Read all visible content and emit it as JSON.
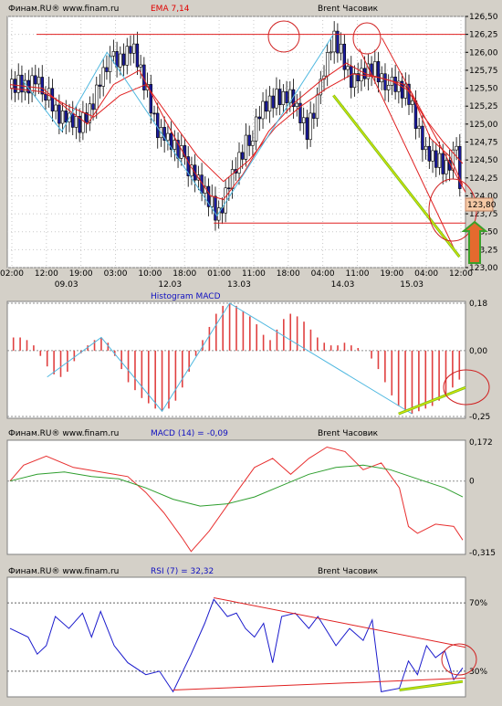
{
  "colors": {
    "background": "#D4D0C8",
    "panel": "#FFFFFF",
    "header_text": "#000000",
    "title_red": "#E00000",
    "title_blue": "#1010C0",
    "candle_up": "#FFFFFF",
    "candle_down": "#1A1AA0",
    "ema": "#E02020",
    "trend_cyan": "#4FB8E0",
    "green_line": "#7CC31E",
    "yellow_line": "#E8E800",
    "macd_line": "#E83030",
    "signal_line": "#2E9E2E",
    "rsi_line": "#1A1ACC",
    "hist_bar": "#E04040",
    "circle": "#D02020",
    "price_box": "#F5C9A5",
    "arrow_fill": "#E56A2E",
    "arrow_border": "#3AA02A"
  },
  "chart_data": [
    {
      "type": "candlestick",
      "header": {
        "source": "Финам.RU® www.finam.ru",
        "indicator": "EMA 7,14",
        "instrument": "Brent Часовик"
      },
      "y_ticks": [
        "126,50",
        "126,25",
        "126,00",
        "125,75",
        "125,50",
        "125,25",
        "125,00",
        "124,75",
        "124,50",
        "124,25",
        "124,00",
        "123,75",
        "123,50",
        "123,25",
        "123,00"
      ],
      "ylim": [
        123.0,
        126.5
      ],
      "current_price": "123,80",
      "x_time_labels": [
        "02:00",
        "12:00",
        "19:00",
        "03:00",
        "10:00",
        "18:00",
        "01:00",
        "11:00",
        "18:00",
        "04:00",
        "11:00",
        "19:00",
        "04:00",
        "12:00"
      ],
      "x_date_labels": [
        "09.03",
        "12.03",
        "13.03",
        "14.03",
        "15.03"
      ],
      "x_range": [
        0,
        140
      ],
      "resistance": 126.25,
      "support": 123.62,
      "close_path": [
        [
          0,
          125.5
        ],
        [
          8,
          125.6
        ],
        [
          16,
          125.1
        ],
        [
          22,
          124.95
        ],
        [
          30,
          125.8
        ],
        [
          38,
          126.05
        ],
        [
          46,
          124.9
        ],
        [
          54,
          124.5
        ],
        [
          58,
          124.2
        ],
        [
          64,
          123.72
        ],
        [
          70,
          124.4
        ],
        [
          78,
          125.2
        ],
        [
          86,
          125.45
        ],
        [
          92,
          124.85
        ],
        [
          100,
          126.2
        ],
        [
          106,
          125.6
        ],
        [
          112,
          125.75
        ],
        [
          118,
          125.55
        ],
        [
          124,
          125.35
        ],
        [
          128,
          124.6
        ],
        [
          134,
          124.4
        ],
        [
          138,
          124.6
        ],
        [
          140,
          123.8
        ]
      ],
      "ema_fast": [
        [
          0,
          125.55
        ],
        [
          10,
          125.5
        ],
        [
          18,
          125.2
        ],
        [
          24,
          125.0
        ],
        [
          32,
          125.55
        ],
        [
          40,
          125.75
        ],
        [
          48,
          125.05
        ],
        [
          56,
          124.4
        ],
        [
          62,
          124.0
        ],
        [
          66,
          123.95
        ],
        [
          72,
          124.3
        ],
        [
          80,
          124.9
        ],
        [
          88,
          125.3
        ],
        [
          96,
          125.6
        ],
        [
          104,
          125.85
        ],
        [
          110,
          125.7
        ],
        [
          118,
          125.6
        ],
        [
          124,
          125.45
        ],
        [
          130,
          124.8
        ],
        [
          136,
          124.55
        ],
        [
          140,
          124.15
        ]
      ],
      "ema_slow": [
        [
          0,
          125.5
        ],
        [
          10,
          125.45
        ],
        [
          18,
          125.25
        ],
        [
          26,
          125.1
        ],
        [
          34,
          125.4
        ],
        [
          42,
          125.55
        ],
        [
          50,
          125.05
        ],
        [
          58,
          124.55
        ],
        [
          66,
          124.2
        ],
        [
          74,
          124.5
        ],
        [
          82,
          124.95
        ],
        [
          90,
          125.25
        ],
        [
          98,
          125.5
        ],
        [
          106,
          125.7
        ],
        [
          114,
          125.65
        ],
        [
          122,
          125.55
        ],
        [
          128,
          125.1
        ],
        [
          134,
          124.75
        ],
        [
          140,
          124.45
        ]
      ]
    },
    {
      "type": "bar",
      "header": {
        "indicator": "Histogram MACD"
      },
      "y_ticks": [
        "0,18",
        "0,00",
        "-0,25"
      ],
      "ylim": [
        -0.25,
        0.18
      ],
      "values": [
        0.05,
        0.05,
        0.04,
        0.02,
        -0.02,
        -0.06,
        -0.09,
        -0.1,
        -0.08,
        -0.04,
        -0.01,
        0.02,
        0.04,
        0.05,
        0.03,
        -0.02,
        -0.07,
        -0.12,
        -0.15,
        -0.18,
        -0.2,
        -0.22,
        -0.23,
        -0.22,
        -0.19,
        -0.14,
        -0.08,
        -0.02,
        0.04,
        0.09,
        0.14,
        0.17,
        0.18,
        0.17,
        0.15,
        0.13,
        0.1,
        0.06,
        0.04,
        0.08,
        0.12,
        0.14,
        0.13,
        0.11,
        0.08,
        0.05,
        0.03,
        0.02,
        0.02,
        0.03,
        0.02,
        0.01,
        0.0,
        -0.03,
        -0.07,
        -0.12,
        -0.17,
        -0.21,
        -0.23,
        -0.24,
        -0.23,
        -0.22,
        -0.21,
        -0.19,
        -0.17,
        -0.14,
        -0.11
      ]
    },
    {
      "type": "line",
      "header": {
        "source": "Финам.RU® www.finam.ru",
        "indicator": "MACD (14) = -0,09",
        "instrument": "Brent Часовик"
      },
      "y_ticks": [
        "0,172",
        "0",
        "-0,315"
      ],
      "ylim": [
        -0.315,
        0.172
      ],
      "x_range": [
        0,
        100
      ],
      "series": [
        {
          "values": [
            [
              0,
              0.0
            ],
            [
              3,
              0.07
            ],
            [
              8,
              0.11
            ],
            [
              14,
              0.06
            ],
            [
              20,
              0.04
            ],
            [
              26,
              0.02
            ],
            [
              30,
              -0.05
            ],
            [
              34,
              -0.14
            ],
            [
              38,
              -0.25
            ],
            [
              40,
              -0.31
            ],
            [
              44,
              -0.22
            ],
            [
              50,
              -0.05
            ],
            [
              54,
              0.06
            ],
            [
              58,
              0.1
            ],
            [
              62,
              0.03
            ],
            [
              66,
              0.1
            ],
            [
              70,
              0.15
            ],
            [
              74,
              0.13
            ],
            [
              78,
              0.05
            ],
            [
              82,
              0.08
            ],
            [
              86,
              -0.03
            ],
            [
              88,
              -0.2
            ],
            [
              90,
              -0.23
            ],
            [
              94,
              -0.19
            ],
            [
              98,
              -0.2
            ],
            [
              100,
              -0.26
            ]
          ]
        },
        {
          "values": [
            [
              0,
              0.0
            ],
            [
              6,
              0.03
            ],
            [
              12,
              0.04
            ],
            [
              18,
              0.02
            ],
            [
              24,
              0.01
            ],
            [
              30,
              -0.03
            ],
            [
              36,
              -0.08
            ],
            [
              42,
              -0.11
            ],
            [
              48,
              -0.1
            ],
            [
              54,
              -0.07
            ],
            [
              60,
              -0.02
            ],
            [
              66,
              0.03
            ],
            [
              72,
              0.06
            ],
            [
              78,
              0.07
            ],
            [
              84,
              0.05
            ],
            [
              90,
              0.01
            ],
            [
              96,
              -0.03
            ],
            [
              100,
              -0.07
            ]
          ]
        }
      ]
    },
    {
      "type": "line",
      "header": {
        "source": "Финам.RU® www.finam.ru",
        "indicator": "RSI (7) = 32,32",
        "instrument": "Brent Часовик"
      },
      "y_ticks": [
        "70%",
        "30%"
      ],
      "ylim": [
        15,
        85
      ],
      "x_range": [
        0,
        100
      ],
      "values": [
        [
          0,
          55
        ],
        [
          4,
          50
        ],
        [
          6,
          40
        ],
        [
          8,
          45
        ],
        [
          10,
          62
        ],
        [
          13,
          55
        ],
        [
          16,
          64
        ],
        [
          18,
          50
        ],
        [
          20,
          65
        ],
        [
          23,
          45
        ],
        [
          26,
          35
        ],
        [
          30,
          28
        ],
        [
          33,
          30
        ],
        [
          36,
          18
        ],
        [
          40,
          40
        ],
        [
          43,
          58
        ],
        [
          45,
          72
        ],
        [
          48,
          62
        ],
        [
          50,
          64
        ],
        [
          52,
          55
        ],
        [
          54,
          50
        ],
        [
          56,
          58
        ],
        [
          58,
          35
        ],
        [
          60,
          62
        ],
        [
          63,
          64
        ],
        [
          66,
          55
        ],
        [
          68,
          62
        ],
        [
          72,
          45
        ],
        [
          75,
          55
        ],
        [
          78,
          48
        ],
        [
          80,
          60
        ],
        [
          82,
          18
        ],
        [
          86,
          20
        ],
        [
          88,
          36
        ],
        [
          90,
          28
        ],
        [
          92,
          45
        ],
        [
          94,
          38
        ],
        [
          96,
          42
        ],
        [
          98,
          25
        ],
        [
          100,
          32
        ]
      ]
    }
  ]
}
